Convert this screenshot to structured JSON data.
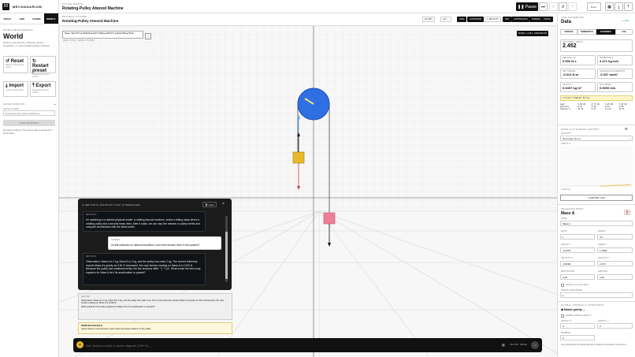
{
  "brand": {
    "name": "MECHANARIUM",
    "logo": "M"
  },
  "left_tabs": [
    "BUILD",
    "LIBS",
    "LEARN",
    "WORLD"
  ],
  "left_active": "WORLD",
  "world": {
    "section": "WORLD MANAGEMENT",
    "title": "World",
    "desc": "Restore experiments, preserve named snapshots, or move worlds between devices.",
    "buttons": [
      {
        "icon": "reset-icon",
        "label": "Reset",
        "desc": "Return to the default scene",
        "glyph": "↺"
      },
      {
        "icon": "restart-icon",
        "label": "Restart preset",
        "desc": "Reload the current preset",
        "glyph": "↻"
      },
      {
        "icon": "import-icon",
        "label": "Import",
        "desc": "Load a world JSON",
        "glyph": "⤓"
      },
      {
        "icon": "export-icon",
        "label": "Export",
        "desc": "Download a world JSON",
        "glyph": "⤒"
      }
    ],
    "saved_section": "SAVED WORLDS",
    "save_name_label": "SAVE NAME",
    "save_placeholder": "Rotating-Pulley Atwood Machine",
    "save_button": "SAVE SNAPSHOT",
    "note": "No saved worlds yet. The current state is autosaved in this browser."
  },
  "header": {
    "subtitle": "ACTIVE WORLD",
    "title": "Rotating-Pulley Atwood Machine",
    "pause": "Pause",
    "zoom": "0.1x"
  },
  "toolbar": {
    "project_label": "PROJECT SYSTEM",
    "project_title": "Rotating-Pulley Atwood Machine",
    "copy": "COPY",
    "speed": "0.1x",
    "buttons": [
      "GRID",
      "CONSTRAIN",
      "1 VELOCITY",
      "SET",
      "CONTINUOUS",
      "FORCES",
      "TRAILS"
    ]
  },
  "canvas": {
    "legend": "MA ■ 1 VELOCITY ■ TENSION ■ NET FORCE ■ GRAVITY ■ SELECTED ■ TRAIL",
    "legend_hint": "DRAG TO PAN · SCROLL TO ZOOM",
    "scale_badge": "MASS A · 0.28 s · GROUND ON"
  },
  "chat": {
    "title": "SECTOR AI ASSISTANT CHAT (6 MESSAGES)",
    "clear": "Clear",
    "messages": [
      {
        "who": "SECTOR AI",
        "text": "I'm switching to a distinct physical model: a rotating Atwood machine, where a falling mass drives a rotating pulley and a second mass rises. After it loads, we can vary the masses or pulley inertia and compare acceleration with the ideal model."
      },
      {
        "who": "STUDENT",
        "text": "im still confused on atwood machines. how does tension work in this system?"
      },
      {
        "who": "SECTOR AI",
        "text": "Observation: Mass A is 1 kg, Mass B is 2 kg, and the pulley has mass 2 kg. The current telemetry reports Mass A's gravity as 9.81 N downward, the rope tension reading on Mass A is 0.000 N. Because the pulley has rotational inertia, the two tensions differ: T₂−T₁≠0. What would the free-body equation for Mass A be if its acceleration is upward?"
      }
    ],
    "pinned": "Observation: Mass A is 1 kg, Mass B is 2 kg, and the pulley has mass 2 kg. The current telemetry reports Mass A's gravity as 9.81 N downward, the rope tension reading on Mass A is 0.000 N...",
    "pinned_q": "What would the free-body equation for Mass A be if its acceleration is upward?",
    "hint_title": "PROBLEM SCAFFOLD",
    "hint": "Apply Newton's second law to each mass and torque balance to the pulley."
  },
  "prompt": {
    "placeholder": "Ask Vector to build or paste diagram (Ctrl+V)...",
    "mode": "VECTOR · SENSE"
  },
  "right": {
    "section": "LIVE TELEMETRY",
    "title": "Data",
    "live": "● LIVE",
    "tabs": [
      "FORCES",
      "KINEMATICS",
      "DYNAMICS",
      "LOG"
    ],
    "active_tab": "DYNAMICS",
    "net_force": {
      "k": "NET FORCE · MASS A",
      "v": "2.452"
    },
    "grid": [
      {
        "k": "IMPULSE (·Δt)",
        "v": "0.000 N·s"
      },
      {
        "k": "MOMENTUM p",
        "v": "3.471 kg·m/s"
      },
      {
        "k": "NET TORQUE",
        "v": "-0.014 N·m"
      },
      {
        "k": "ANGULAR ACCELERATION",
        "v": "-0.337 rad/s²"
      },
      {
        "k": "VELOCITY",
        "v": "0.0457 kg·m²"
      },
      {
        "k": "SLIP SPEED",
        "v": "0.0000 m/s"
      }
    ],
    "equation": "I = Σ mr² + ½ Mp R² · Στ = Iα",
    "table": [
      [
        "Load",
        "5.84 kN",
        "4.73 kN",
        "5.25 kN",
        "3.29 kN"
      ],
      [
        "Velocity",
        "0.31",
        "0.40",
        "0.31",
        "0.00"
      ],
      [
        "Tension A",
        "12.14",
        "9.13",
        "12.44",
        "10.71"
      ]
    ],
    "history_title": "MASS & DYNAMICS HISTORY",
    "quantity_label": "QUANTITY",
    "quantity": "Net torque (N·m)",
    "history_top": "0.000 N·m",
    "history_bottom": "-0.022 N·m",
    "export_csv": "EXPORT CSV",
    "selected_label": "SELECTED BODY",
    "selected": "Mass A",
    "fields": [
      {
        "k": "NAME",
        "v": "Mass A",
        "full": true
      },
      {
        "k": "MASS",
        "v": "1"
      },
      {
        "k": "RADIUS",
        "v": "0.2"
      },
      {
        "k": "ANGLE X",
        "v": "-0.2379"
      },
      {
        "k": "ANGLE Y",
        "v": "1.7829"
      },
      {
        "k": "VELOCITY X",
        "v": "-0.0000"
      },
      {
        "k": "VELOCITY Y",
        "v": "2.473"
      },
      {
        "k": "RESTITUTION",
        "v": "0.35"
      },
      {
        "k": "FRICTION",
        "v": "0.16"
      }
    ],
    "ignore_label": "Reinforce and lock object",
    "gravity_scale_label": "GRAVITY MULTIPLIER",
    "gravity_scale": "1",
    "global_title": "GLOBAL FORCES & CONSTANTS",
    "master_gravity": "Master gravity",
    "enable_gravity": "ENABLE WORLD GRAVITY",
    "gx_label": "GRAVITY X",
    "gx": "0",
    "gy_label": "GRAVITY Y",
    "gy": "0",
    "damping_label": "DAMPING",
    "damping": "0",
    "footnote": "Use world gravity and global damping to adjust the simulation environment."
  }
}
